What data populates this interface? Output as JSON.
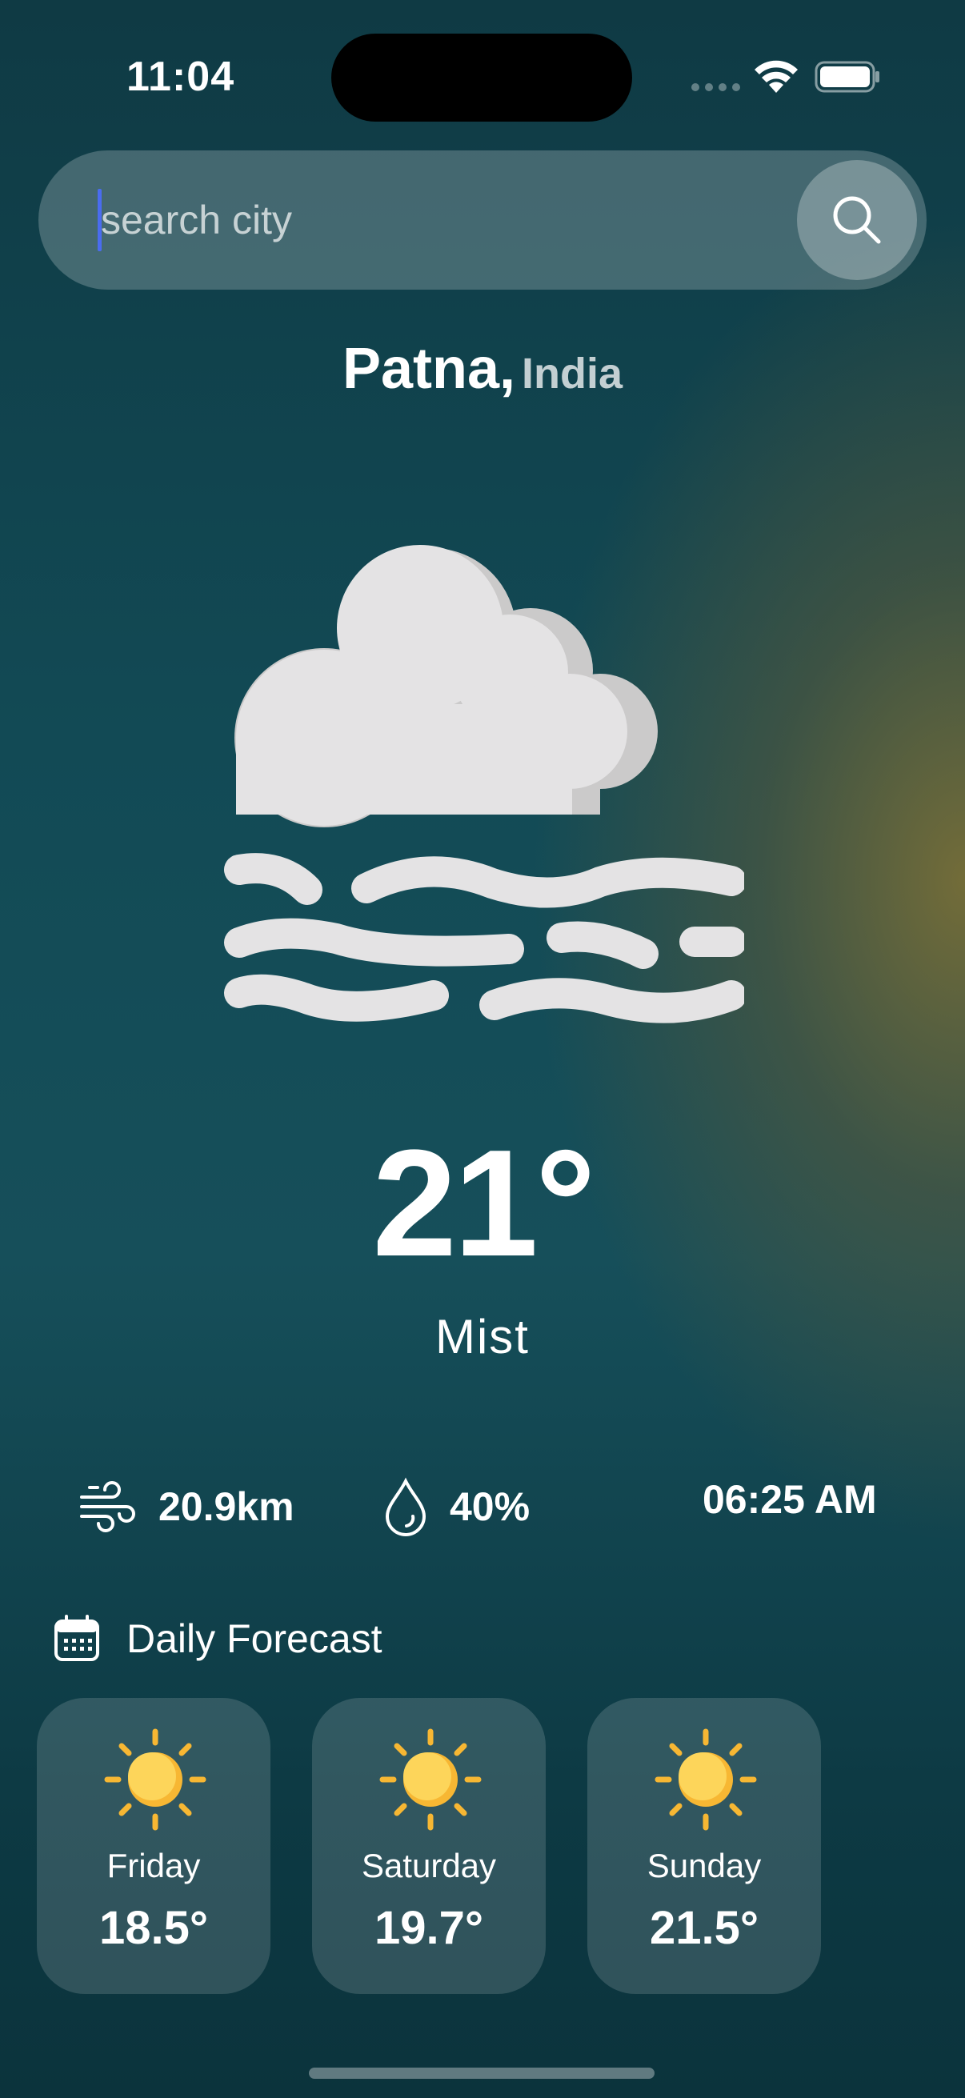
{
  "status_bar": {
    "time": "11:04"
  },
  "search": {
    "placeholder": "search city",
    "value": ""
  },
  "location": {
    "city": "Patna,",
    "country": "India"
  },
  "current": {
    "temperature": "21°",
    "condition": "Mist",
    "icon": "mist-cloud-icon"
  },
  "stats": {
    "wind": {
      "value": "20.9km",
      "icon": "wind-icon"
    },
    "humidity": {
      "value": "40%",
      "icon": "drop-icon"
    },
    "sunrise": {
      "value": "06:25 AM",
      "icon": "sun-icon"
    }
  },
  "forecast": {
    "title": "Daily Forecast",
    "icon": "calendar-icon",
    "days": [
      {
        "day": "Friday",
        "temp": "18.5°",
        "icon": "sun-icon"
      },
      {
        "day": "Saturday",
        "temp": "19.7°",
        "icon": "sun-icon"
      },
      {
        "day": "Sunday",
        "temp": "21.5°",
        "icon": "sun-icon"
      }
    ]
  },
  "colors": {
    "caret": "#4a6cf0",
    "sun": "#fdd55a",
    "sun_ray": "#f7b733"
  }
}
